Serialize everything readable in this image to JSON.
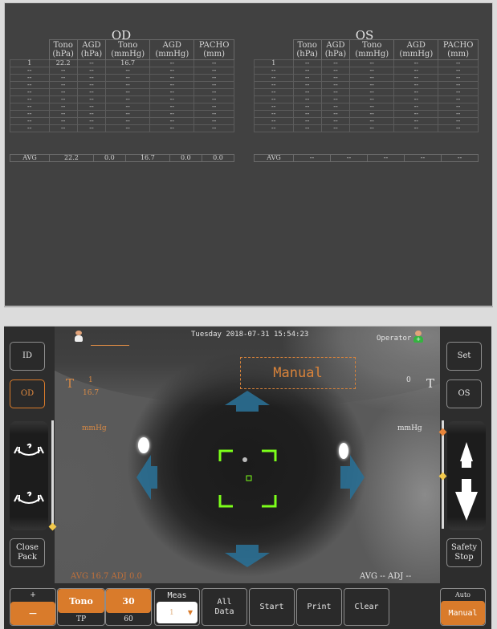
{
  "results": {
    "columns": [
      {
        "line1": "Tono",
        "line2": "(hPa)"
      },
      {
        "line1": "AGD",
        "line2": "(hPa)"
      },
      {
        "line1": "Tono",
        "line2": "(mmHg)"
      },
      {
        "line1": "AGD",
        "line2": "(mmHg)"
      },
      {
        "line1": "PACHO",
        "line2": "(mm)"
      }
    ],
    "od": {
      "title": "OD",
      "rows": [
        [
          "1",
          "22.2",
          "--",
          "16.7",
          "--",
          "--"
        ],
        [
          "--",
          "--",
          "--",
          "--",
          "--",
          "--"
        ],
        [
          "--",
          "--",
          "--",
          "--",
          "--",
          "--"
        ],
        [
          "--",
          "--",
          "--",
          "--",
          "--",
          "--"
        ],
        [
          "--",
          "--",
          "--",
          "--",
          "--",
          "--"
        ],
        [
          "--",
          "--",
          "--",
          "--",
          "--",
          "--"
        ],
        [
          "--",
          "--",
          "--",
          "--",
          "--",
          "--"
        ],
        [
          "--",
          "--",
          "--",
          "--",
          "--",
          "--"
        ],
        [
          "--",
          "--",
          "--",
          "--",
          "--",
          "--"
        ],
        [
          "--",
          "--",
          "--",
          "--",
          "--",
          "--"
        ]
      ],
      "avg": [
        "AVG",
        "22.2",
        "0.0",
        "16.7",
        "0.0",
        "0.0"
      ]
    },
    "os": {
      "title": "OS",
      "rows": [
        [
          "1",
          "--",
          "--",
          "--",
          "--",
          "--"
        ],
        [
          "--",
          "--",
          "--",
          "--",
          "--",
          "--"
        ],
        [
          "--",
          "--",
          "--",
          "--",
          "--",
          "--"
        ],
        [
          "--",
          "--",
          "--",
          "--",
          "--",
          "--"
        ],
        [
          "--",
          "--",
          "--",
          "--",
          "--",
          "--"
        ],
        [
          "--",
          "--",
          "--",
          "--",
          "--",
          "--"
        ],
        [
          "--",
          "--",
          "--",
          "--",
          "--",
          "--"
        ],
        [
          "--",
          "--",
          "--",
          "--",
          "--",
          "--"
        ],
        [
          "--",
          "--",
          "--",
          "--",
          "--",
          "--"
        ],
        [
          "--",
          "--",
          "--",
          "--",
          "--",
          "--"
        ]
      ],
      "avg": [
        "AVG",
        "--",
        "--",
        "--",
        "--",
        "--"
      ]
    }
  },
  "header": {
    "datetime": "Tuesday 2018-07-31 15:54:23",
    "operator_label": "Operator",
    "patient_name": ""
  },
  "overlay": {
    "mode": "Manual",
    "left": {
      "t_label": "T",
      "count": "1",
      "value": "16.7",
      "unit": "mmHg",
      "avg": "AVG 16.7 ADJ 0.0"
    },
    "right": {
      "t_label": "T",
      "count": "0",
      "unit": "mmHg",
      "avg": "AVG -- ADJ --"
    }
  },
  "left_buttons": {
    "id": "ID",
    "od": "OD",
    "close_pack": "Close\nPack"
  },
  "right_buttons": {
    "set": "Set",
    "os": "OS",
    "safety_stop": "Safety\nStop"
  },
  "bottom": {
    "plus_minus": {
      "plus": "+",
      "minus": "−"
    },
    "mode_toggle": {
      "active": "Tono",
      "inactive": "TP"
    },
    "interval_toggle": {
      "active": "30",
      "inactive": "60"
    },
    "meas": {
      "label": "Meas",
      "value": "1"
    },
    "all_data": "All\nData",
    "start": "Start",
    "print": "Print",
    "clear": "Clear",
    "auto_manual": {
      "inactive": "Auto",
      "active": "Manual"
    }
  },
  "colors": {
    "accent": "#d97b2b",
    "arrow": "#2a6f93",
    "reticle": "#7cff1a",
    "panel": "#414141"
  }
}
